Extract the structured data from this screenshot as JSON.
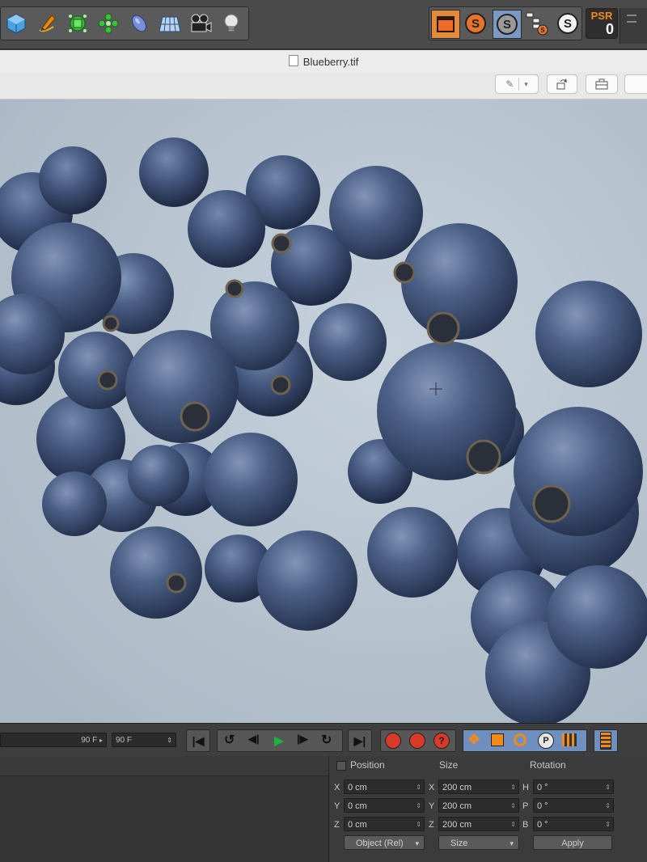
{
  "toolbar": {
    "tools": [
      "cube-icon",
      "pen-icon",
      "subdivision-icon",
      "cloner-icon",
      "deformer-icon",
      "floor-icon",
      "camera-icon",
      "light-icon"
    ],
    "right_tools": [
      "render-view-icon",
      "s-orange-icon",
      "s-gray-icon",
      "hierarchy-icon",
      "s-white-icon"
    ],
    "psr": {
      "label": "PSR",
      "value": "0"
    }
  },
  "viewer": {
    "title": "Blueberry.tif"
  },
  "timeline": {
    "field_max_left": "90 F",
    "field_max_right": "90 F"
  },
  "attributes": {
    "headers": {
      "position": "Position",
      "size": "Size",
      "rotation": "Rotation"
    },
    "rows": [
      {
        "pos_axis": "X",
        "pos_value": "0 cm",
        "size_axis": "X",
        "size_value": "200 cm",
        "rot_axis": "H",
        "rot_value": "0 °"
      },
      {
        "pos_axis": "Y",
        "pos_value": "0 cm",
        "size_axis": "Y",
        "size_value": "200 cm",
        "rot_axis": "P",
        "rot_value": "0 °"
      },
      {
        "pos_axis": "Z",
        "pos_value": "0 cm",
        "size_axis": "Z",
        "size_value": "200 cm",
        "rot_axis": "B",
        "rot_value": "0 °"
      }
    ],
    "mode_dropdown": "Object (Rel)",
    "size_dropdown": "Size",
    "apply_label": "Apply"
  }
}
